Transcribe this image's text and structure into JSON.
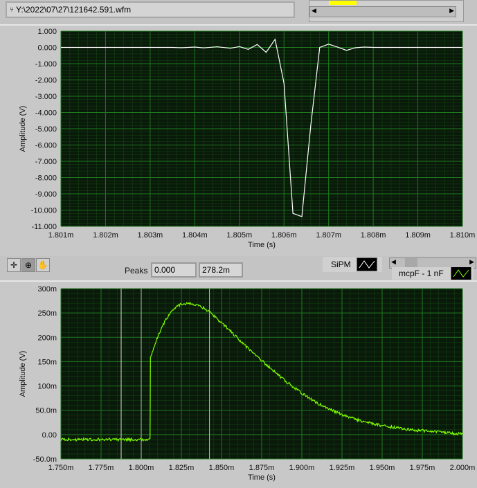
{
  "file_path": "Y:\\2022\\07\\27\\121642.591.wfm",
  "palette": {
    "plot_bg": "#0a1a0a",
    "grid": "#1f7a1f",
    "top_trace": "#ffffff",
    "bottom_trace": "#7fff00"
  },
  "toolbar": {
    "tools": [
      "cursor-tool",
      "zoom-tool",
      "pan-tool"
    ]
  },
  "peaks": {
    "label": "Peaks",
    "value1": "0.000",
    "value2": "278.2m"
  },
  "legend": {
    "sipm": "SiPM",
    "mcp": "mcpF - 1 nF"
  },
  "chart_data": [
    {
      "type": "line",
      "xlabel": "Time (s)",
      "ylabel": "Amplitude (V)",
      "xlim": [
        1.801,
        1.81
      ],
      "ylim": [
        -11,
        1
      ],
      "xticks": [
        "1.801m",
        "1.802m",
        "1.803m",
        "1.804m",
        "1.805m",
        "1.806m",
        "1.807m",
        "1.808m",
        "1.809m",
        "1.810m"
      ],
      "yticks": [
        "1.000",
        "0.000",
        "-1.000",
        "-2.000",
        "-3.000",
        "-4.000",
        "-5.000",
        "-6.000",
        "-7.000",
        "-8.000",
        "-9.000",
        "-10.000",
        "-11.000"
      ],
      "series": [
        {
          "name": "SiPM",
          "x": [
            1.801,
            1.8035,
            1.8037,
            1.804,
            1.8042,
            1.8045,
            1.8048,
            1.805,
            1.8052,
            1.8054,
            1.8056,
            1.8058,
            1.806,
            1.8062,
            1.8064,
            1.8066,
            1.8068,
            1.807,
            1.8072,
            1.8074,
            1.8076,
            1.8078,
            1.808,
            1.81
          ],
          "y": [
            0,
            0,
            -0.02,
            0.02,
            -0.03,
            0.04,
            -0.05,
            0.05,
            -0.12,
            0.18,
            -0.3,
            0.5,
            -2.2,
            -10.2,
            -10.4,
            -4.8,
            0,
            0.2,
            0.02,
            -0.18,
            -0.02,
            0.02,
            0,
            0
          ]
        }
      ]
    },
    {
      "type": "line",
      "xlabel": "Time (s)",
      "ylabel": "Amplitude (V)",
      "xlim": [
        1.75,
        2.0
      ],
      "ylim": [
        -0.05,
        0.3
      ],
      "xticks": [
        "1.750m",
        "1.775m",
        "1.800m",
        "1.825m",
        "1.850m",
        "1.875m",
        "1.900m",
        "1.925m",
        "1.950m",
        "1.975m",
        "2.000m"
      ],
      "yticks": [
        "300m",
        "250m",
        "200m",
        "150m",
        "100m",
        "50.0m",
        "0.00",
        "-50.0m"
      ],
      "cursors": [
        1.7875,
        1.8,
        1.8425
      ],
      "series": [
        {
          "name": "mcpF - 1 nF",
          "x": [
            1.75,
            1.8055,
            1.806,
            1.81,
            1.815,
            1.82,
            1.825,
            1.83,
            1.835,
            1.84,
            1.845,
            1.85,
            1.855,
            1.86,
            1.865,
            1.87,
            1.875,
            1.88,
            1.885,
            1.89,
            1.895,
            1.9,
            1.905,
            1.91,
            1.915,
            1.92,
            1.925,
            1.93,
            1.935,
            1.94,
            1.945,
            1.95,
            1.955,
            1.96,
            1.965,
            1.97,
            1.975,
            1.98,
            1.985,
            1.99,
            1.995,
            2.0
          ],
          "y": [
            -0.01,
            -0.01,
            0.16,
            0.2,
            0.235,
            0.258,
            0.268,
            0.27,
            0.266,
            0.258,
            0.245,
            0.23,
            0.215,
            0.198,
            0.182,
            0.167,
            0.152,
            0.138,
            0.123,
            0.11,
            0.097,
            0.085,
            0.074,
            0.064,
            0.056,
            0.048,
            0.041,
            0.035,
            0.03,
            0.025,
            0.022,
            0.018,
            0.016,
            0.013,
            0.011,
            0.009,
            0.008,
            0.006,
            0.005,
            0.004,
            0.002,
            0.001
          ]
        }
      ]
    }
  ]
}
